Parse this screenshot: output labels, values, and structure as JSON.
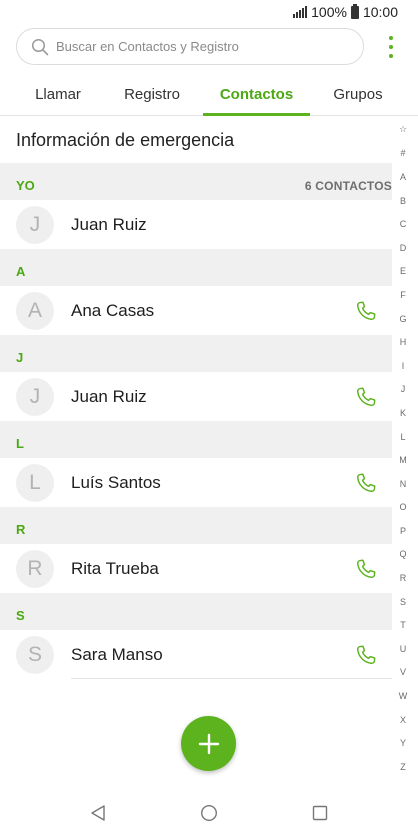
{
  "status": {
    "battery": "100%",
    "time": "10:00"
  },
  "search": {
    "placeholder": "Buscar en Contactos y Registro"
  },
  "tabs": [
    {
      "label": "Llamar",
      "active": false
    },
    {
      "label": "Registro",
      "active": false
    },
    {
      "label": "Contactos",
      "active": true
    },
    {
      "label": "Grupos",
      "active": false
    }
  ],
  "emergency": {
    "label": "Información de emergencia"
  },
  "sections": [
    {
      "letter": "YO",
      "count": "6 CONTACTOS",
      "contacts": [
        {
          "initial": "J",
          "name": "Juan Ruiz",
          "call": false
        }
      ]
    },
    {
      "letter": "A",
      "contacts": [
        {
          "initial": "A",
          "name": "Ana Casas",
          "call": true
        }
      ]
    },
    {
      "letter": "J",
      "contacts": [
        {
          "initial": "J",
          "name": "Juan Ruiz",
          "call": true
        }
      ]
    },
    {
      "letter": "L",
      "contacts": [
        {
          "initial": "L",
          "name": "Luís Santos",
          "call": true
        }
      ]
    },
    {
      "letter": "R",
      "contacts": [
        {
          "initial": "R",
          "name": "Rita Trueba",
          "call": true
        }
      ]
    },
    {
      "letter": "S",
      "contacts": [
        {
          "initial": "S",
          "name": "Sara Manso",
          "call": true
        }
      ]
    }
  ],
  "alphabet_index": [
    "☆",
    "#",
    "A",
    "B",
    "C",
    "D",
    "E",
    "F",
    "G",
    "H",
    "I",
    "J",
    "K",
    "L",
    "M",
    "N",
    "O",
    "P",
    "Q",
    "R",
    "S",
    "T",
    "U",
    "V",
    "W",
    "X",
    "Y",
    "Z"
  ],
  "icons": {
    "search": "search-icon",
    "menu": "more-vertical-icon",
    "call": "phone-icon",
    "fab": "plus-icon",
    "nav_back": "back-triangle-icon",
    "nav_home": "home-circle-icon",
    "nav_recent": "recent-square-icon"
  },
  "colors": {
    "accent": "#5cb31e",
    "accent_text": "#4ca813",
    "section_bg": "#f0f0f0"
  }
}
